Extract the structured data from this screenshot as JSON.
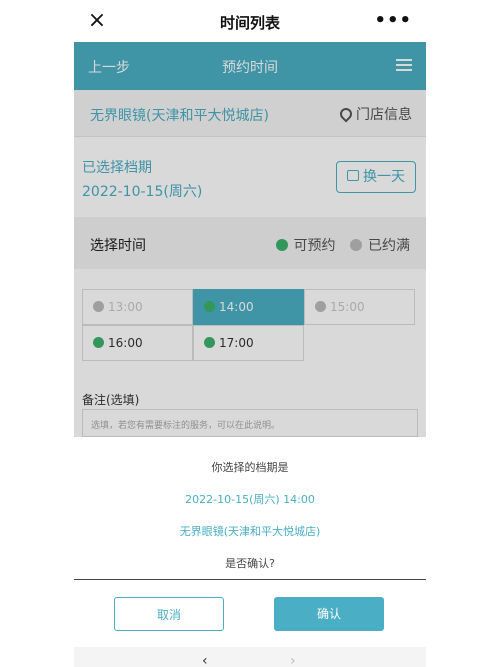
{
  "titlebar": {
    "title": "时间列表",
    "close_icon": "×",
    "more_icon": "•••"
  },
  "nav": {
    "back_label": "上一步",
    "title": "预约时间",
    "menu_icon": "hamburger-icon"
  },
  "store": {
    "name": "无界眼镜(天津和平大悦城店)",
    "info_label": "门店信息"
  },
  "date": {
    "label": "已选择档期",
    "value": "2022-10-15(周六)",
    "change_label": "换一天"
  },
  "time": {
    "label": "选择时间",
    "legend_available": "可预约",
    "legend_full": "已约满",
    "slots": [
      {
        "time": "13:00",
        "state": "full"
      },
      {
        "time": "14:00",
        "state": "selected"
      },
      {
        "time": "15:00",
        "state": "full"
      },
      {
        "time": "16:00",
        "state": "available"
      },
      {
        "time": "17:00",
        "state": "available"
      }
    ]
  },
  "notes": {
    "label": "备注(选填)",
    "placeholder": "选填，若您有需要标注的服务，可以在此说明。"
  },
  "dialog": {
    "question": "你选择的档期是",
    "datetime": "2022-10-15(周六) 14:00",
    "store": "无界眼镜(天津和平大悦城店)",
    "confirm_question": "是否确认?",
    "cancel_label": "取消",
    "ok_label": "确认"
  },
  "colors": {
    "accent": "#4aaec4",
    "available": "#3db26b",
    "full": "#bbbbbb"
  }
}
